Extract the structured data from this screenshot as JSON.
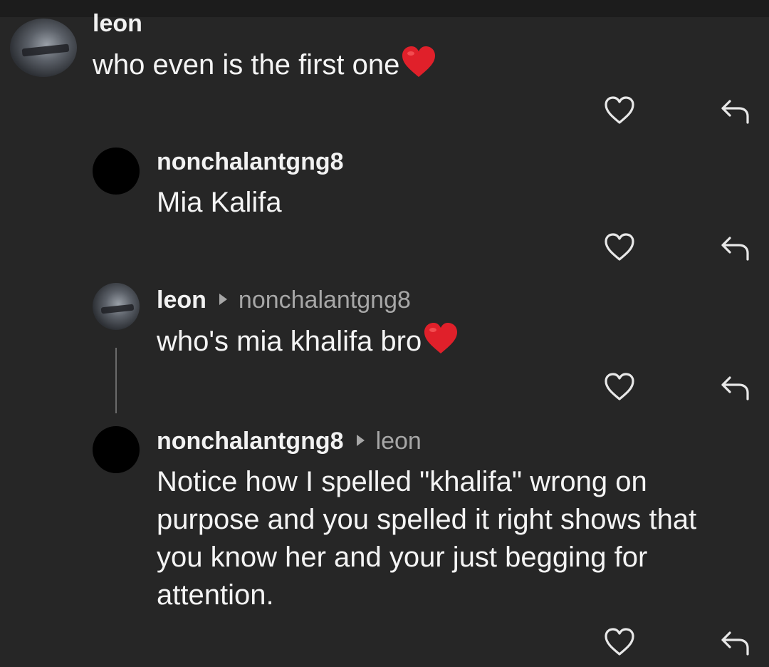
{
  "comments": [
    {
      "username": "leon",
      "reply_to": "",
      "text": "who even is the first one",
      "emoji": "heart"
    },
    {
      "username": "nonchalantgng8",
      "reply_to": "",
      "text": "Mia Kalifa",
      "emoji": ""
    },
    {
      "username": "leon",
      "reply_to": "nonchalantgng8",
      "text": "who's mia khalifa bro",
      "emoji": "heart"
    },
    {
      "username": "nonchalantgng8",
      "reply_to": "leon",
      "text": "Notice how I spelled \"khalifa\" wrong on purpose and you spelled it right shows that you know her and your just begging for attention.",
      "emoji": ""
    }
  ],
  "icons": {
    "like": "heart-outline-icon",
    "reply": "reply-arrow-icon",
    "reply_indicator": "triangle-right-icon",
    "emoji": "red-heart-emoji"
  },
  "colors": {
    "background": "#262626",
    "text": "#f2f2f2",
    "muted": "#a7a7a7",
    "emoji_red": "#e0202a"
  }
}
